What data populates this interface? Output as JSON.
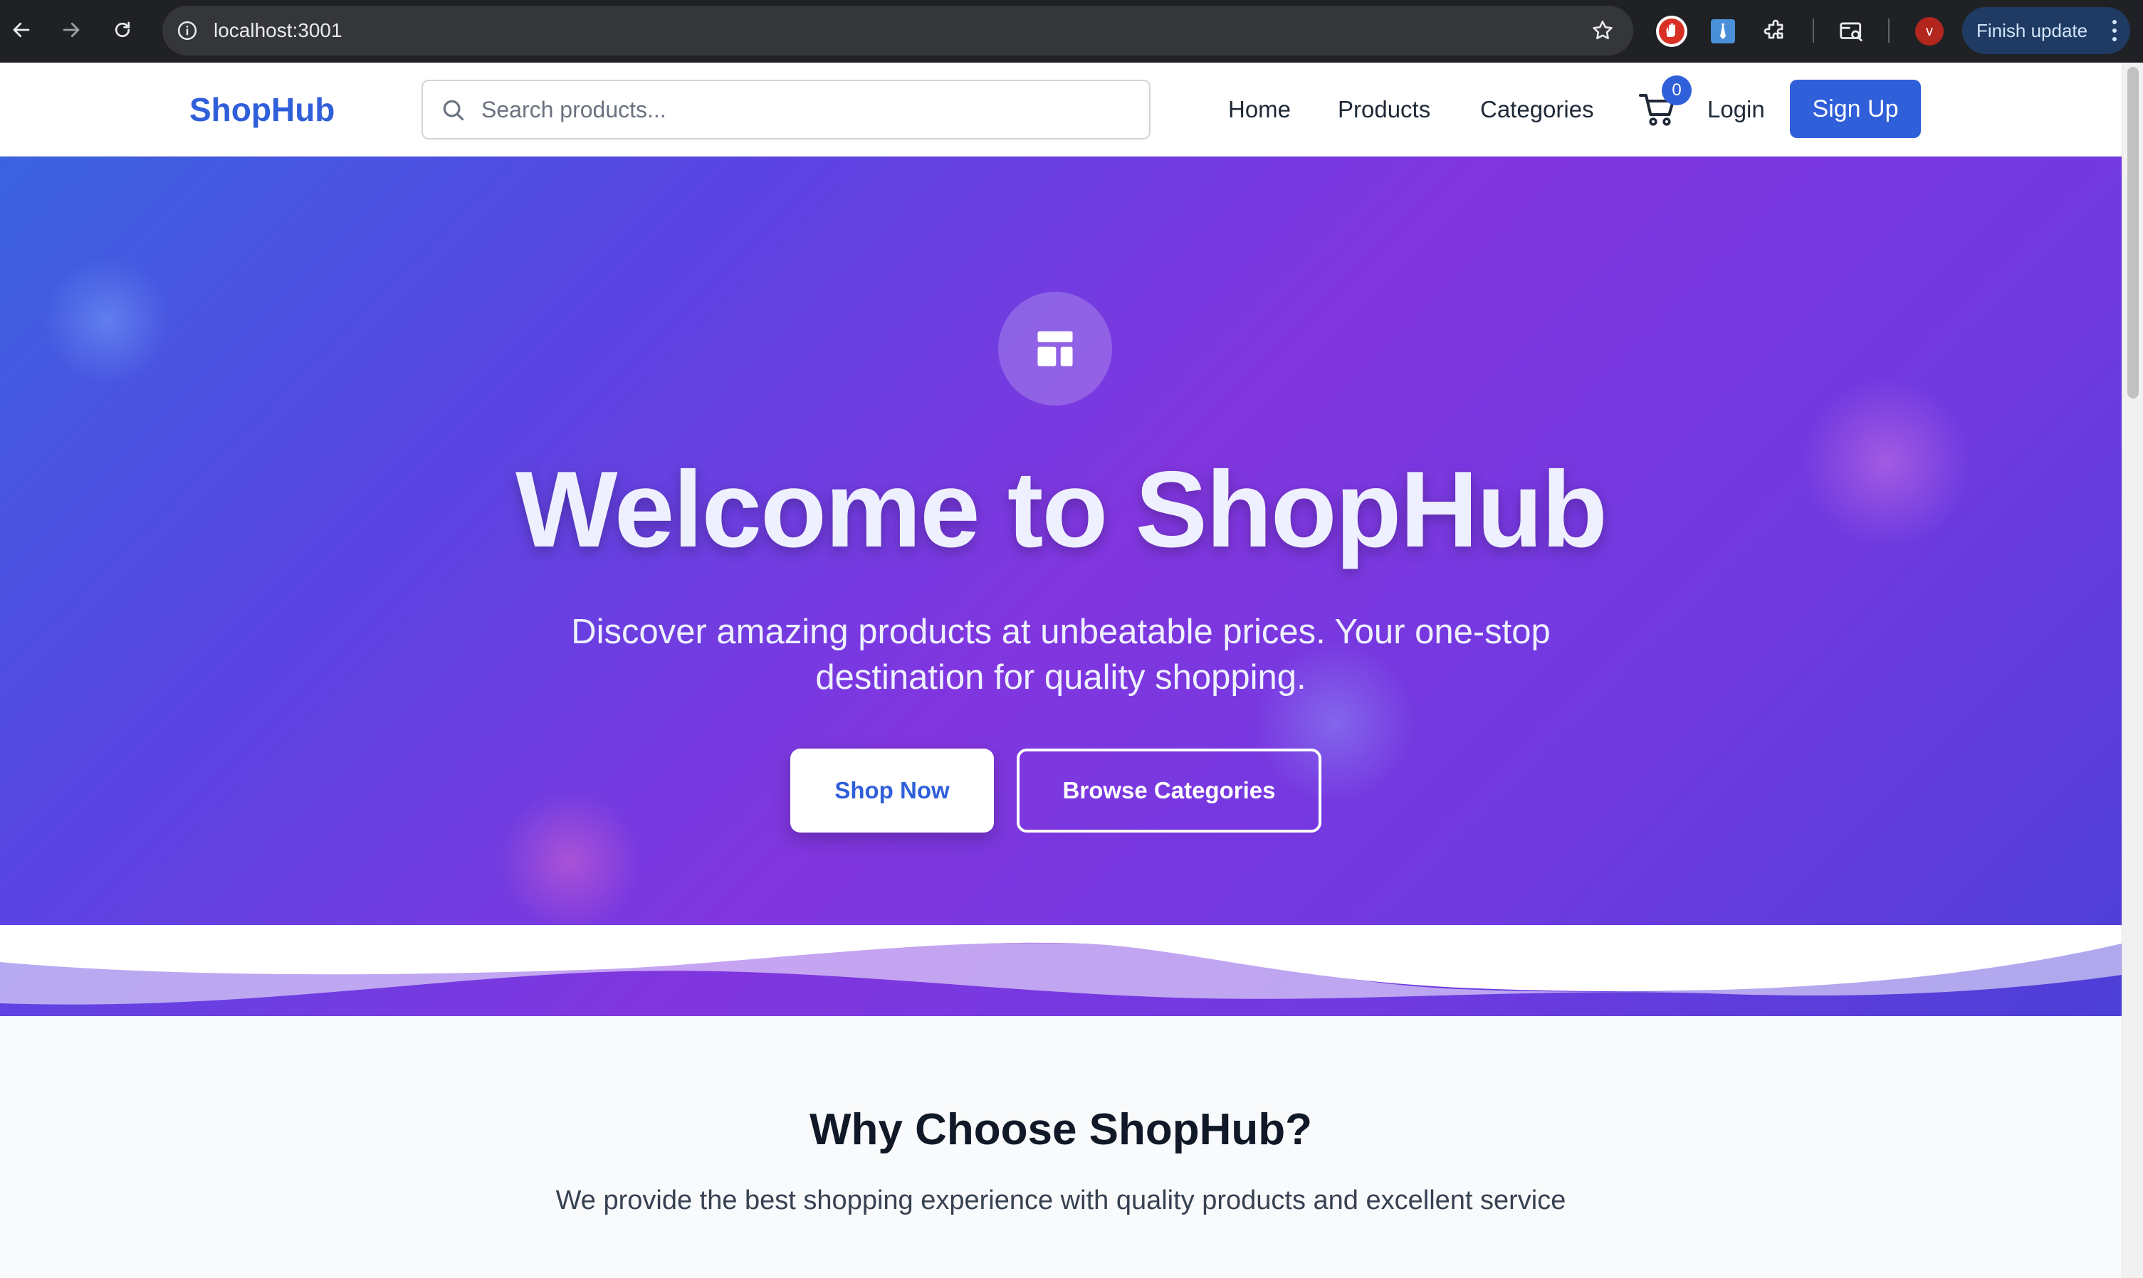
{
  "browser": {
    "url": "localhost:3001",
    "update_label": "Finish update",
    "profile_initial": "v"
  },
  "header": {
    "logo": "ShopHub",
    "search_placeholder": "Search products...",
    "nav": [
      "Home",
      "Products",
      "Categories"
    ],
    "cart_count": "0",
    "login": "Login",
    "signup": "Sign Up"
  },
  "hero": {
    "title": "Welcome to ShopHub",
    "subtitle": "Discover amazing products at unbeatable prices. Your one-stop destination for quality shopping.",
    "primary_cta": "Shop Now",
    "secondary_cta": "Browse Categories"
  },
  "features": {
    "title": "Why Choose ShopHub?",
    "subtitle": "We provide the best shopping experience with quality products and excellent service"
  },
  "colors": {
    "brand": "#2f5fd9",
    "hero_gradient_start": "#3a63e0",
    "hero_gradient_mid": "#8136df",
    "hero_gradient_end": "#4c3fd6",
    "section_bg": "#f8fafc"
  },
  "icons": {
    "hero": "layout-template-icon",
    "cart": "shopping-cart-icon",
    "search": "search-icon"
  }
}
